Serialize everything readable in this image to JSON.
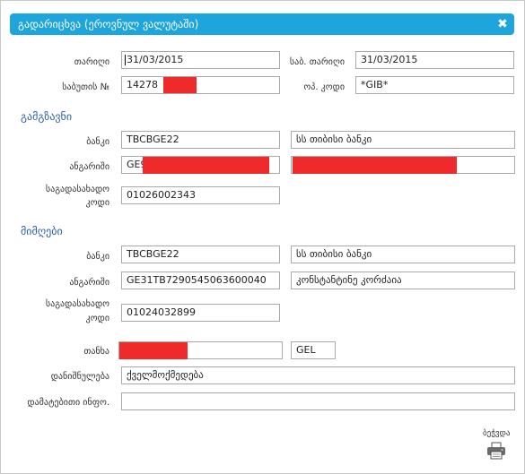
{
  "dialog": {
    "title": "გადარიცხვა (ეროვნულ ვალუტაში)",
    "close_icon": "close-icon",
    "accent": "#1ea5dc"
  },
  "header": {
    "date_label": "თარიღი",
    "date_value": "31/03/2015",
    "bank_date_label": "საბ. თარიღი",
    "bank_date_value": "31/03/2015",
    "doc_number_label": "საბუთის №",
    "doc_number_value": "14278",
    "op_code_label": "ოპ. კოდი",
    "op_code_value": "*GIB*"
  },
  "sender": {
    "section_title": "გამგზავნი",
    "bank_label": "ბანკი",
    "bank_code": "TBCBGE22",
    "bank_name": "სს  თიბისი  ბანკი",
    "account_label": "ანგარიში",
    "account_value": "GE9",
    "account_name": "",
    "tax_label_line1": "საგადასახადო",
    "tax_label_line2": "კოდი",
    "tax_code": "01026002343"
  },
  "receiver": {
    "section_title": "მიმღები",
    "bank_label": "ბანკი",
    "bank_code": "TBCBGE22",
    "bank_name": "სს  თიბისი  ბანკი",
    "account_label": "ანგარიში",
    "account_value": "GE31TB7290545063600040",
    "account_name": "კონსტანტინე კორძაია",
    "tax_label_line1": "საგადასახადო",
    "tax_label_line2": "კოდი",
    "tax_code": "01024032899"
  },
  "payment": {
    "amount_label": "თანხა",
    "amount_value": "",
    "currency": "GEL",
    "purpose_label": "დანიშნულება",
    "purpose_value": "ქველმოქმედება",
    "extra_info_label": "დამატებითი ინფო.",
    "extra_info_value": ""
  },
  "footer": {
    "print_label": "ბეჭვდა",
    "print_icon": "printer-icon"
  },
  "redaction_color": "#ee2a2a"
}
